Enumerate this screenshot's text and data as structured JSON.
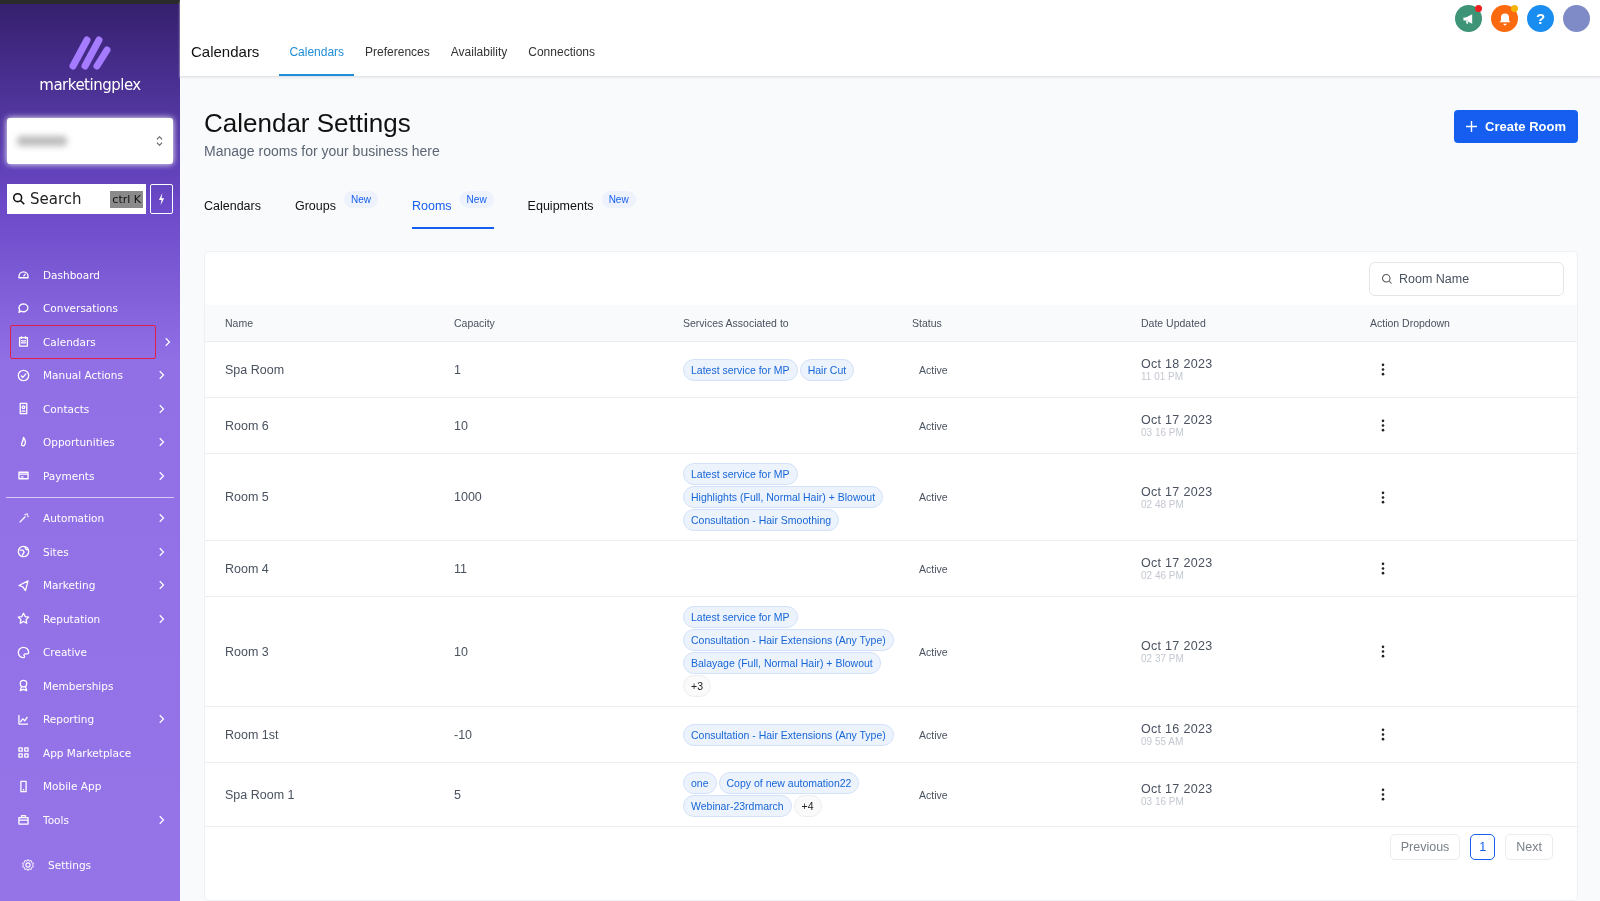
{
  "sidebar": {
    "logo": "marketingplex",
    "search": {
      "placeholder": "Search",
      "shortcut": "ctrl K"
    },
    "sections": [
      [
        {
          "label": "Dashboard",
          "selected": false,
          "has_submenu": false
        },
        {
          "label": "Conversations",
          "selected": false,
          "has_submenu": false
        },
        {
          "label": "Calendars",
          "selected": true,
          "has_submenu": true
        },
        {
          "label": "Manual Actions",
          "selected": false,
          "has_submenu": true
        },
        {
          "label": "Contacts",
          "selected": false,
          "has_submenu": true
        },
        {
          "label": "Opportunities",
          "selected": false,
          "has_submenu": true
        },
        {
          "label": "Payments",
          "selected": false,
          "has_submenu": true
        }
      ],
      [
        {
          "label": "Automation",
          "selected": false,
          "has_submenu": true
        },
        {
          "label": "Sites",
          "selected": false,
          "has_submenu": true
        },
        {
          "label": "Marketing",
          "selected": false,
          "has_submenu": true
        },
        {
          "label": "Reputation",
          "selected": false,
          "has_submenu": true
        },
        {
          "label": "Creative",
          "selected": false,
          "has_submenu": false
        },
        {
          "label": "Memberships",
          "selected": false,
          "has_submenu": false
        },
        {
          "label": "Reporting",
          "selected": false,
          "has_submenu": true
        },
        {
          "label": "App Marketplace",
          "selected": false,
          "has_submenu": false
        },
        {
          "label": "Mobile App",
          "selected": false,
          "has_submenu": false
        },
        {
          "label": "Tools",
          "selected": false,
          "has_submenu": true
        }
      ]
    ],
    "settings": "Settings"
  },
  "top_bar": {
    "title": "Calendars",
    "tabs": [
      {
        "label": "Calendars",
        "selected": true
      },
      {
        "label": "Preferences",
        "selected": false
      },
      {
        "label": "Availability",
        "selected": false
      },
      {
        "label": "Connections",
        "selected": false
      }
    ],
    "icons": [
      {
        "kind": "megaphone",
        "color": "#f01f1f"
      },
      {
        "kind": "bell",
        "color": "#f5b400"
      },
      {
        "kind": "help",
        "glyph": "?"
      },
      {
        "kind": "avatar"
      }
    ]
  },
  "page": {
    "title": "Calendar Settings",
    "subtitle": "Manage rooms for your business here",
    "create_button": "Create Room",
    "tabs": [
      {
        "label": "Calendars",
        "selected": false
      },
      {
        "label": "Groups",
        "selected": false,
        "badge": "New"
      },
      {
        "label": "Rooms",
        "selected": true,
        "badge": "New"
      },
      {
        "label": "Equipments",
        "selected": false,
        "badge": "New"
      }
    ]
  },
  "table": {
    "search": {
      "placeholder": "Room Name"
    },
    "columns": [
      "Name",
      "Capacity",
      "Services Associated to",
      "Status",
      "Date Updated",
      "Action Dropdown"
    ],
    "rows": [
      {
        "name": "Spa Room",
        "capacity": "1",
        "services": [
          {
            "kind": "service",
            "label": "Latest service for MP"
          },
          {
            "kind": "service",
            "label": "Hair Cut"
          }
        ],
        "status": "Active",
        "date": "Oct 18 2023",
        "time": "11 01 PM"
      },
      {
        "name": "Room 6",
        "capacity": "10",
        "services": [],
        "status": "Active",
        "date": "Oct 17 2023",
        "time": "03 16 PM"
      },
      {
        "name": "Room 5",
        "capacity": "1000",
        "services": [
          {
            "kind": "service",
            "label": "Latest service for MP"
          },
          {
            "kind": "service",
            "label": "Highlights (Full, Normal Hair) + Blowout"
          },
          {
            "kind": "service",
            "label": "Consultation - Hair Smoothing"
          }
        ],
        "status": "Active",
        "date": "Oct 17 2023",
        "time": "02 48 PM"
      },
      {
        "name": "Room 4",
        "capacity": "11",
        "services": [],
        "status": "Active",
        "date": "Oct 17 2023",
        "time": "02 46 PM"
      },
      {
        "name": "Room 3",
        "capacity": "10",
        "services": [
          {
            "kind": "service",
            "label": "Latest service for MP"
          },
          {
            "kind": "service",
            "label": "Consultation - Hair Extensions (Any Type)"
          },
          {
            "kind": "service",
            "label": "Balayage (Full, Normal Hair) + Blowout"
          },
          {
            "kind": "more",
            "label": "+3"
          }
        ],
        "status": "Active",
        "date": "Oct 17 2023",
        "time": "02 37 PM"
      },
      {
        "name": "Room 1st",
        "capacity": "-10",
        "services": [
          {
            "kind": "service",
            "label": "Consultation - Hair Extensions (Any Type)"
          }
        ],
        "status": "Active",
        "date": "Oct 16 2023",
        "time": "09 55 AM"
      },
      {
        "name": "Spa Room 1",
        "capacity": "5",
        "services": [
          {
            "kind": "service",
            "label": "one"
          },
          {
            "kind": "service",
            "label": "Copy of new automation22"
          },
          {
            "kind": "service",
            "label": "Webinar-23rdmarch"
          },
          {
            "kind": "more",
            "label": "+4"
          }
        ],
        "status": "Active",
        "date": "Oct 17 2023",
        "time": "03 16 PM"
      }
    ]
  },
  "pagination": {
    "previous": "Previous",
    "pages": [
      {
        "label": "1",
        "selected": true
      }
    ],
    "next": "Next"
  }
}
